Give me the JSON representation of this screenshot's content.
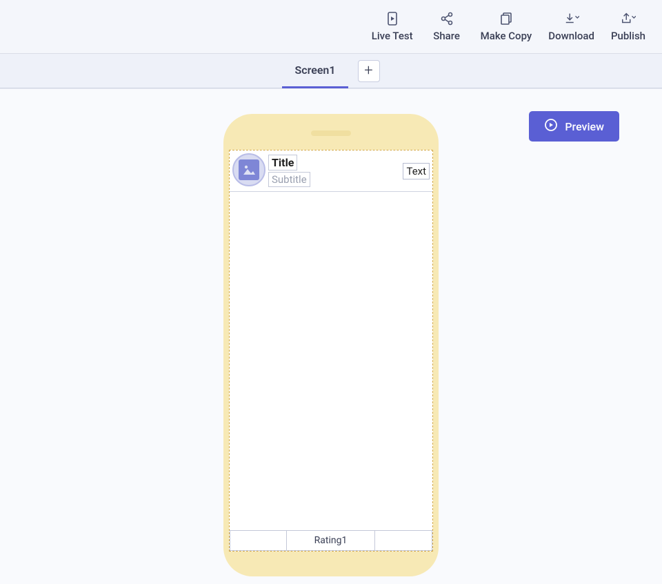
{
  "toolbar": {
    "live_test": "Live Test",
    "share": "Share",
    "make_copy": "Make Copy",
    "download": "Download",
    "publish": "Publish"
  },
  "tabs": {
    "active": "Screen1",
    "add_symbol": "+"
  },
  "preview": {
    "label": "Preview"
  },
  "list_item": {
    "title": "Title",
    "subtitle": "Subtitle",
    "right_text": "Text"
  },
  "rating": {
    "label": "Rating1"
  }
}
